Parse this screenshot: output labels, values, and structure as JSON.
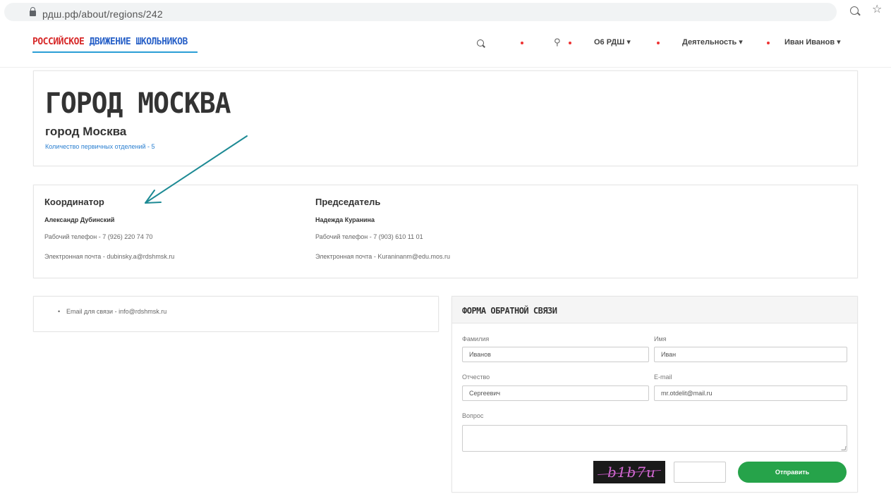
{
  "browser": {
    "url": "рдш.рф/about/regions/242"
  },
  "nav": {
    "logo_part1": "РОССИЙСКОЕ",
    "logo_part2": "ДВИЖЕНИЕ ШКОЛЬНИКОВ",
    "about_label": "О6 РДШ ▾",
    "activity_label": "Деятельность ▾",
    "user_label": "Иван Иванов ▾"
  },
  "region": {
    "title": "ГОРОД МОСКВА",
    "subtitle": "город Москва",
    "branch_count": "Количество первичных отделений - 5"
  },
  "coordinator": {
    "heading": "Координатор",
    "name": "Александр Дубинский",
    "phone": "Рабочий телефон - 7 (926) 220 74 70",
    "email": "Электронная почта - dubinsky.a@rdshmsk.ru"
  },
  "chairman": {
    "heading": "Председатель",
    "name": "Надежда Куранина",
    "phone": "Рабочий телефон - 7 (903) 610 11 01",
    "email": "Электронная почта - Kuraninanm@edu.mos.ru"
  },
  "contacts": {
    "email_line": "Email для связи - info@rdshmsk.ru"
  },
  "form": {
    "title": "ФОРМА ОБРАТНОЙ СВЯЗИ",
    "surname_label": "Фамилия",
    "surname_value": "Иванов",
    "name_label": "Имя",
    "name_value": "Иван",
    "patronymic_label": "Отчество",
    "patronymic_value": "Сергеевич",
    "email_label": "E-mail",
    "email_value": "mr.otdelit@mail.ru",
    "question_label": "Вопрос",
    "captcha_text": "b1b7u",
    "submit_label": "Отправить"
  },
  "colors": {
    "accent_green": "#26a34a",
    "logo_red": "#d72a2a",
    "logo_blue": "#2a62c8",
    "arrow_teal": "#1d8a94",
    "link_blue": "#2a7fd0"
  }
}
